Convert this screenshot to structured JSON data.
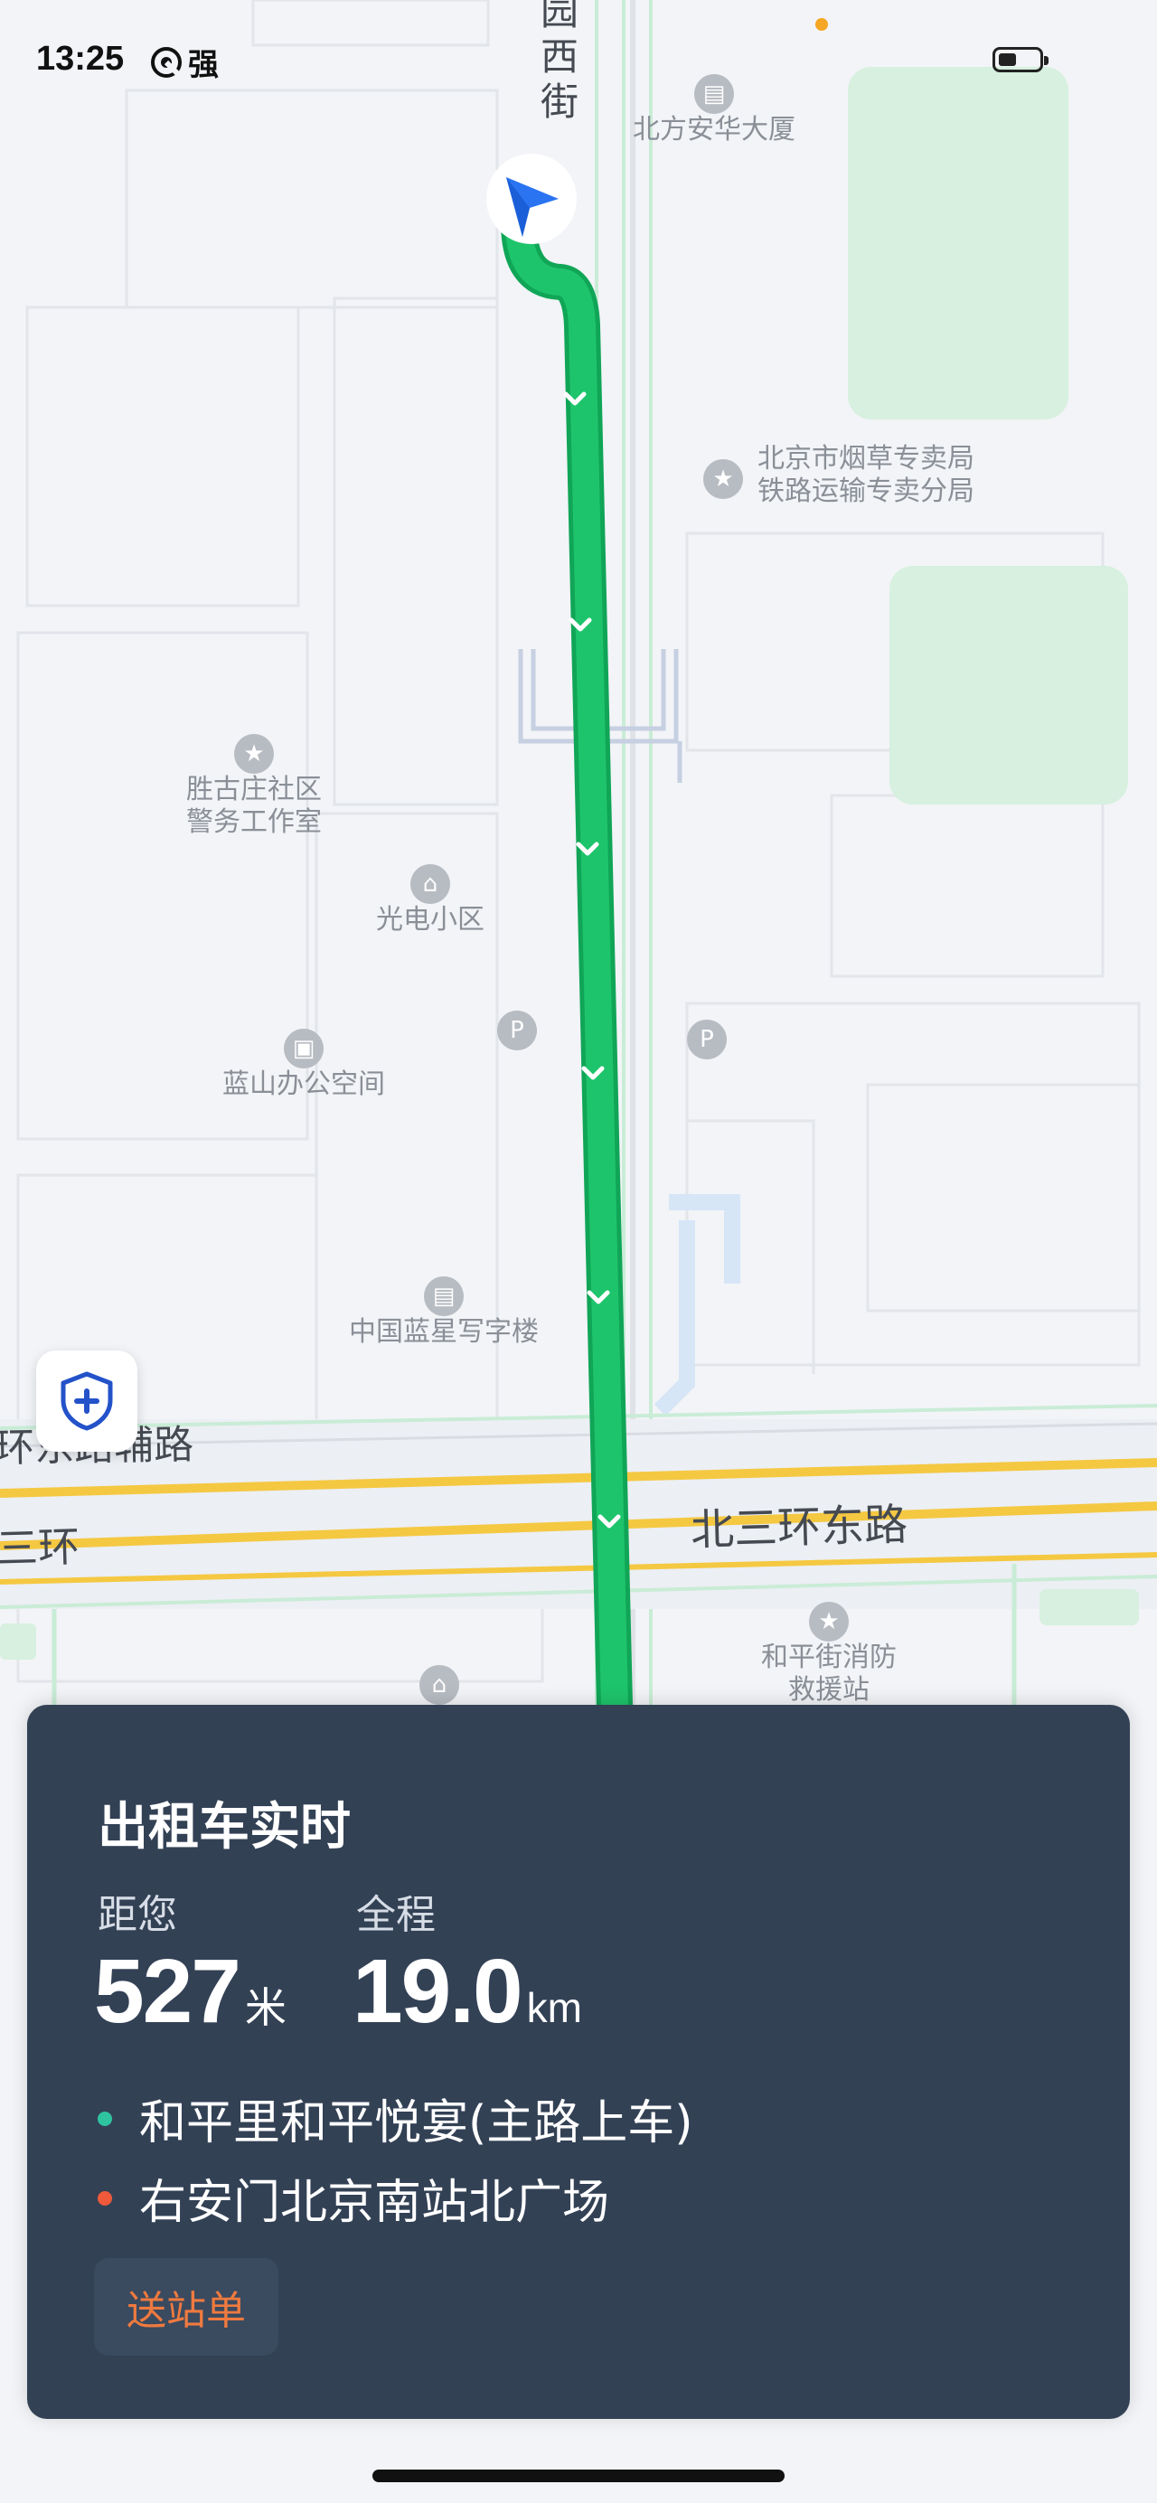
{
  "status_bar": {
    "time": "13:25",
    "network_label": "强",
    "battery_level": 0.45
  },
  "map": {
    "road_labels": {
      "west_street": "园西街",
      "ring_aux": "环东路辅路",
      "ring_main_left": "三环",
      "ring_main_right": "北三环东路"
    },
    "pois": {
      "beifang_anhua": "北方安华大厦",
      "tobacco_line1": "北京市烟草专卖局",
      "tobacco_line2": "铁路运输专卖分局",
      "police_line1": "胜古庄社区",
      "police_line2": "警务工作室",
      "guangdian": "光电小区",
      "parking_p": "P",
      "lanshan": "蓝山办公空间",
      "lanxing": "中国蓝星写字楼",
      "fire_line1": "和平街消防",
      "fire_line2": "救援站"
    },
    "colors": {
      "route": "#1ec46b",
      "route_border": "#10a557",
      "major_road": "#f5c842",
      "park": "#d7f0df"
    }
  },
  "card": {
    "title": "出租车实时",
    "distance_label": "距您",
    "distance_value": "527",
    "distance_unit": "米",
    "total_label": "全程",
    "total_value": "19.0",
    "total_unit": "km",
    "pickup": "和平里和平悦宴(主路上车)",
    "dropoff": "右安门北京南站北广场",
    "send_button": "送站单",
    "colors": {
      "pickup_dot": "#2ec4a0",
      "dropoff_dot": "#f05a3a"
    }
  }
}
